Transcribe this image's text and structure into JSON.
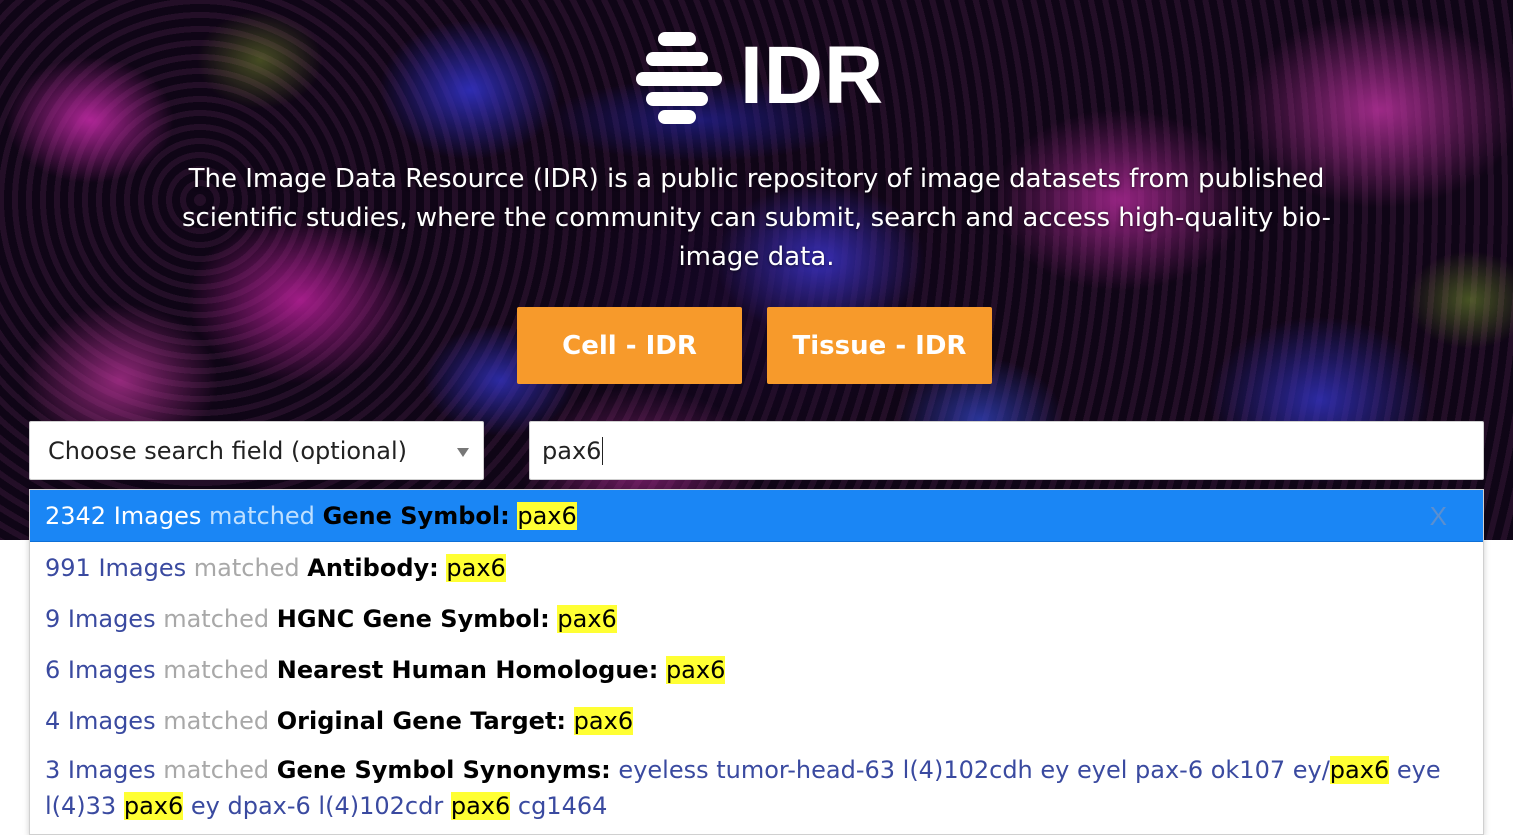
{
  "logo": {
    "text": "IDR"
  },
  "tagline": "The Image Data Resource (IDR) is a public repository of image datasets from published scientific studies, where the community can submit, search and access high-quality bio-image data.",
  "buttons": {
    "cell": "Cell - IDR",
    "tissue": "Tissue - IDR"
  },
  "search": {
    "field_select": "Choose search field (optional)",
    "query": "pax6"
  },
  "results": [
    {
      "count": "2342 Images",
      "matched": "matched",
      "field": "Gene Symbol:",
      "value": "pax6",
      "active": true,
      "close": "X"
    },
    {
      "count": "991 Images",
      "matched": "matched",
      "field": "Antibody:",
      "value": "pax6"
    },
    {
      "count": "9 Images",
      "matched": "matched",
      "field": "HGNC Gene Symbol:",
      "value": "pax6"
    },
    {
      "count": "6 Images",
      "matched": "matched",
      "field": "Nearest Human Homologue:",
      "value": "pax6"
    },
    {
      "count": "4 Images",
      "matched": "matched",
      "field": "Original Gene Target:",
      "value": "pax6"
    },
    {
      "count": "3 Images",
      "matched": "matched",
      "field": "Gene Symbol Synonyms:",
      "synonyms": {
        "part1": "eyeless tumor-head-63 l(4)102cdh ey eyel pax-6 ok107 ey/",
        "hl1": "pax6",
        "part2": " eye l(4)33 ",
        "hl2": "pax6",
        "part3": " ey dpax-6 l(4)102cdr ",
        "hl3": "pax6",
        "part4": " cg1464"
      }
    }
  ],
  "colors": {
    "accent_button": "#f79a2b",
    "active_row": "#1a86f5",
    "highlight": "#ffff33",
    "link_text": "#3a4aa0"
  }
}
